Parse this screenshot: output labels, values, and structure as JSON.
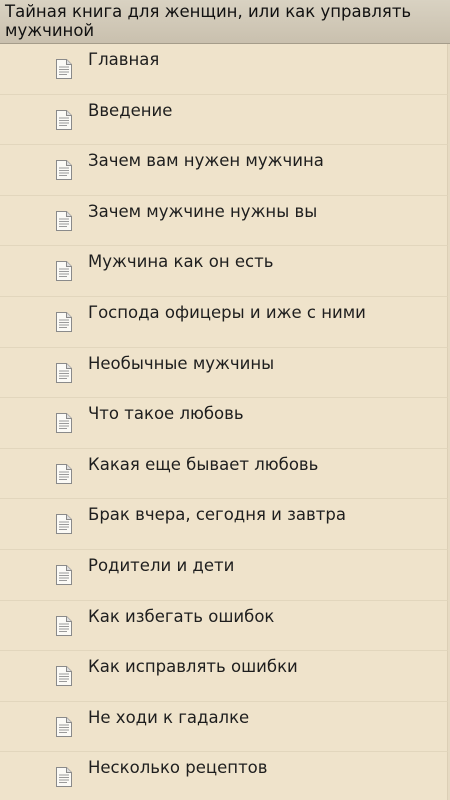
{
  "header": {
    "title": "Тайная книга для женщин, или как управлять мужчиной"
  },
  "menu": {
    "icon": "document-icon",
    "items": [
      {
        "label": "Главная"
      },
      {
        "label": "Введение"
      },
      {
        "label": "Зачем вам нужен мужчина"
      },
      {
        "label": "Зачем мужчине нужны вы"
      },
      {
        "label": "Мужчина как он есть"
      },
      {
        "label": "Господа офицеры и иже с ними"
      },
      {
        "label": "Необычные мужчины"
      },
      {
        "label": "Что такое любовь"
      },
      {
        "label": "Какая еще бывает любовь"
      },
      {
        "label": "Брак вчера, сегодня и завтра"
      },
      {
        "label": "Родители и дети"
      },
      {
        "label": "Как избегать ошибок"
      },
      {
        "label": "Как исправлять ошибки"
      },
      {
        "label": "Не ходи к гадалке"
      },
      {
        "label": "Несколько рецептов"
      }
    ]
  },
  "colors": {
    "background": "#efe3cb",
    "titlebar": "#d0c8b6",
    "text": "#1e1e1e"
  }
}
